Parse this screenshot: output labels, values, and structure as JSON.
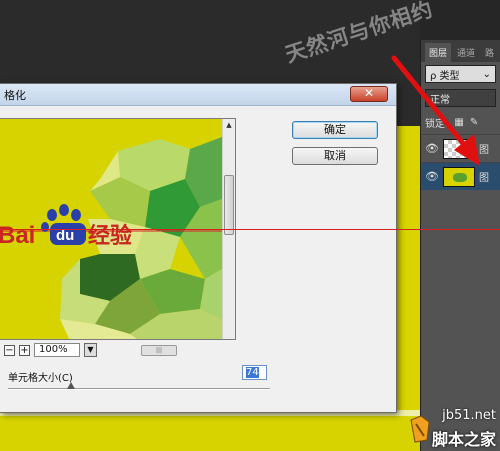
{
  "dialog": {
    "title": "格化",
    "close_symbol": "✕",
    "ok_label": "确定",
    "cancel_label": "取消",
    "zoom_value": "100%",
    "zoom_minus": "−",
    "zoom_plus": "+",
    "zoom_dropdown_symbol": "▼",
    "param_label": "单元格大小(C)",
    "param_value": "74",
    "param_fraction": 0.24,
    "preview_logo_bai": "Bai",
    "preview_logo_du": "du",
    "preview_logo_text": "经验"
  },
  "layers_panel": {
    "tabs": [
      "图层",
      "通道",
      "路"
    ],
    "filter_label": "ρ 类型",
    "blend_mode": "正常",
    "lock_label": "锁定:",
    "layers": [
      {
        "name": "图",
        "thumb": "transparent",
        "eye": "👁"
      },
      {
        "name": "图",
        "thumb": "yellow",
        "eye": "👁"
      }
    ]
  },
  "watermark": {
    "text": "天然河与你相约"
  },
  "site": {
    "url": "jb51.net",
    "name": "脚本之家"
  },
  "colors": {
    "canvas_yellow": "#d6d300",
    "guide_red": "#d92020",
    "baidu_red": "#c8261f",
    "baidu_blue": "#2a3fa8"
  }
}
